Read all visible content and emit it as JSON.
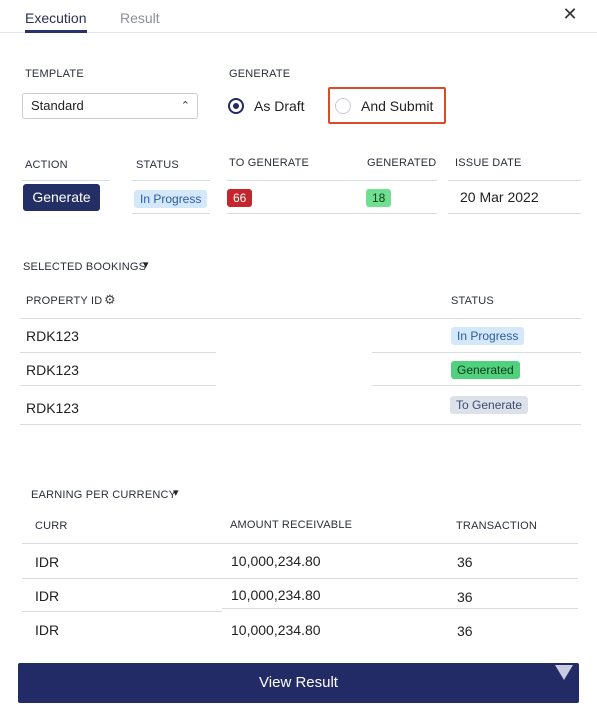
{
  "tabs": [
    {
      "label": "Execution",
      "active": true
    },
    {
      "label": "Result",
      "active": false
    }
  ],
  "close_icon": "close-icon",
  "template": {
    "label": "TEMPLATE",
    "value": "Standard"
  },
  "generate": {
    "label": "GENERATE",
    "options": [
      {
        "label": "As Draft",
        "selected": true
      },
      {
        "label": "And Submit",
        "selected": false
      }
    ]
  },
  "status_table": {
    "headers": {
      "action": "ACTION",
      "status": "STATUS",
      "to_generate": "TO GENERATE",
      "generated": "GENERATED",
      "issue_date": "ISSUE DATE"
    },
    "row": {
      "action": "Generate",
      "status": "In Progress",
      "to_generate": "66",
      "generated": "18",
      "issue_date": "20 Mar 2022"
    }
  },
  "bookings": {
    "title": "SELECTED BOOKINGS",
    "headers": {
      "property_id": "PROPERTY ID",
      "status": "STATUS"
    },
    "rows": [
      {
        "property_id": "RDK123",
        "status": "In Progress"
      },
      {
        "property_id": "RDK123",
        "status": "Generated"
      },
      {
        "property_id": "RDK123",
        "status": "To Generate"
      }
    ]
  },
  "earnings": {
    "title": "EARNING PER CURRENCY",
    "headers": {
      "curr": "CURR",
      "amount": "AMOUNT RECEIVABLE",
      "transaction": "TRANSACTION"
    },
    "rows": [
      {
        "curr": "IDR",
        "amount": "10,000,234.80",
        "transaction": "36"
      },
      {
        "curr": "IDR",
        "amount": "10,000,234.80",
        "transaction": "36"
      },
      {
        "curr": "IDR",
        "amount": "10,000,234.80",
        "transaction": "36"
      }
    ]
  },
  "footer": {
    "button": "View Result"
  },
  "colors": {
    "accent": "#243065",
    "highlight": "#e0482a",
    "badge_progress": "#d4e8fb",
    "badge_generated": "#4fd17e",
    "badge_red": "#c4262d"
  }
}
